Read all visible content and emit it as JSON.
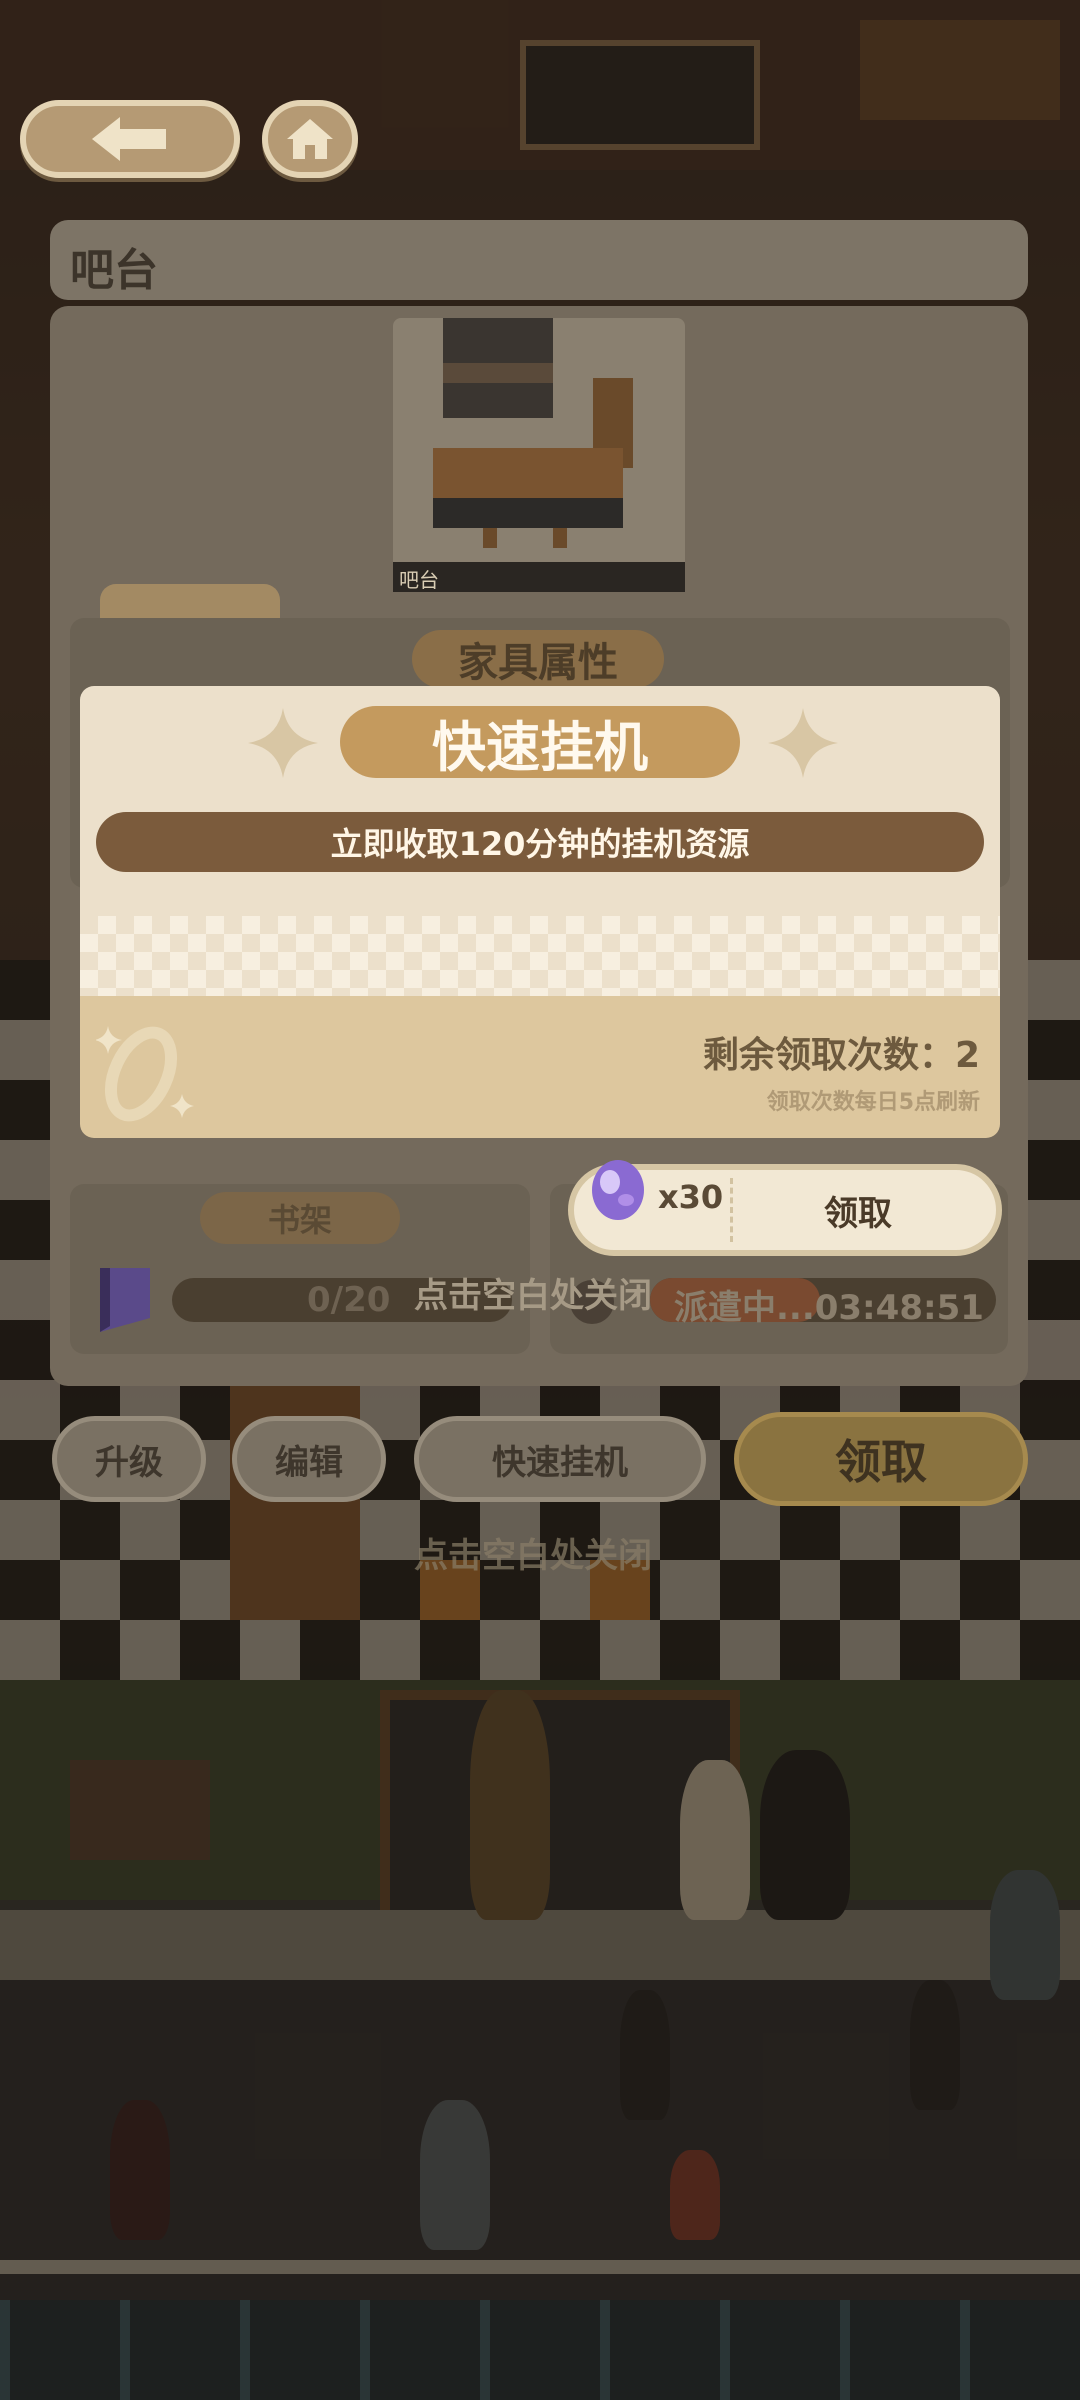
{
  "nav": {
    "back_icon": "arrow-left-icon",
    "home_icon": "home-icon"
  },
  "panel": {
    "title": "吧台",
    "furniture_caption": "吧台",
    "tab_label": "领取",
    "attr_title": "家具属性",
    "bookshelf_label": "书架",
    "bookshelf_progress": "0/20",
    "dispatch_status": "派遣中...03:48:51",
    "tap_close_hint": "点击空白处关闭"
  },
  "popup": {
    "title": "快速挂机",
    "subtitle": "立即收取120分钟的挂机资源",
    "remaining_label": "剩余领取次数：2",
    "refresh_note": "领取次数每日5点刷新",
    "reward_qty": "x30",
    "claim_label": "领取"
  },
  "bottom_bar": {
    "upgrade": "升级",
    "edit": "编辑",
    "quick_idle": "快速挂机",
    "claim": "领取"
  },
  "background_hint": "点击空白处关闭",
  "colors": {
    "accent": "#c49a5e",
    "brown": "#7b5b3c",
    "cream": "#ece0cb",
    "claim_gold": "#c9a24b"
  }
}
